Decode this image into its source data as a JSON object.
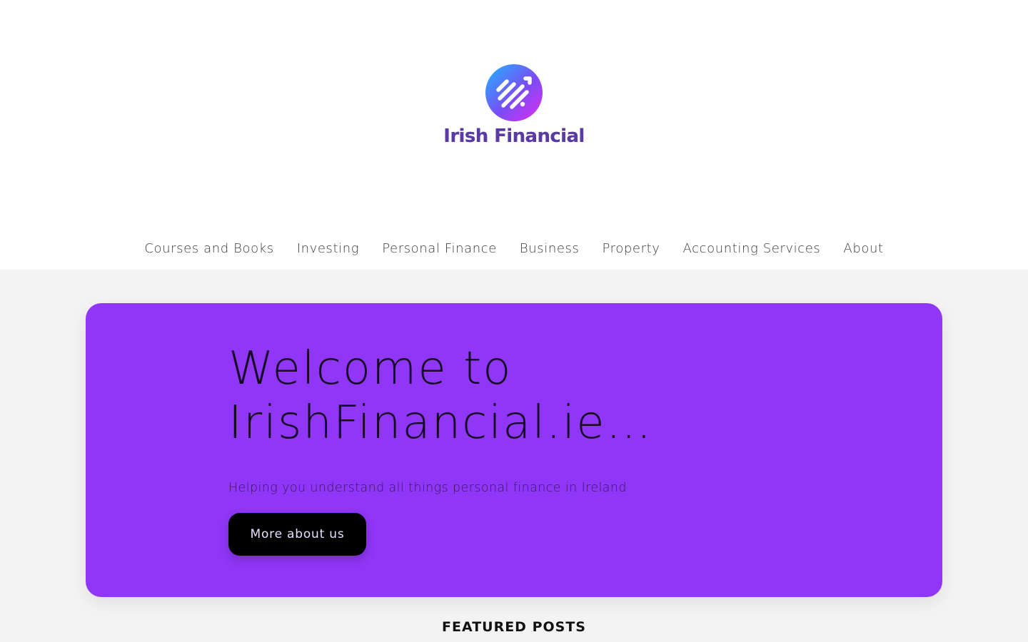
{
  "brand": {
    "name": "Irish Financial",
    "logo_icon": "rising-chart-stripes-icon",
    "colors": {
      "gradient_start": "#1fb6ff",
      "gradient_end": "#c532f2",
      "wordmark": "#5b3aa6"
    }
  },
  "nav": {
    "items": [
      {
        "label": "Courses and Books"
      },
      {
        "label": "Investing"
      },
      {
        "label": "Personal Finance"
      },
      {
        "label": "Business"
      },
      {
        "label": "Property"
      },
      {
        "label": "Accounting Services"
      },
      {
        "label": "About"
      }
    ]
  },
  "hero": {
    "title_line1": "Welcome to",
    "title_line2": "IrishFinancial.ie…",
    "subtitle": "Helping you understand all things personal finance in Ireland",
    "button_label": "More about us",
    "background": "#9036f7"
  },
  "featured": {
    "heading": "FEATURED POSTS"
  }
}
